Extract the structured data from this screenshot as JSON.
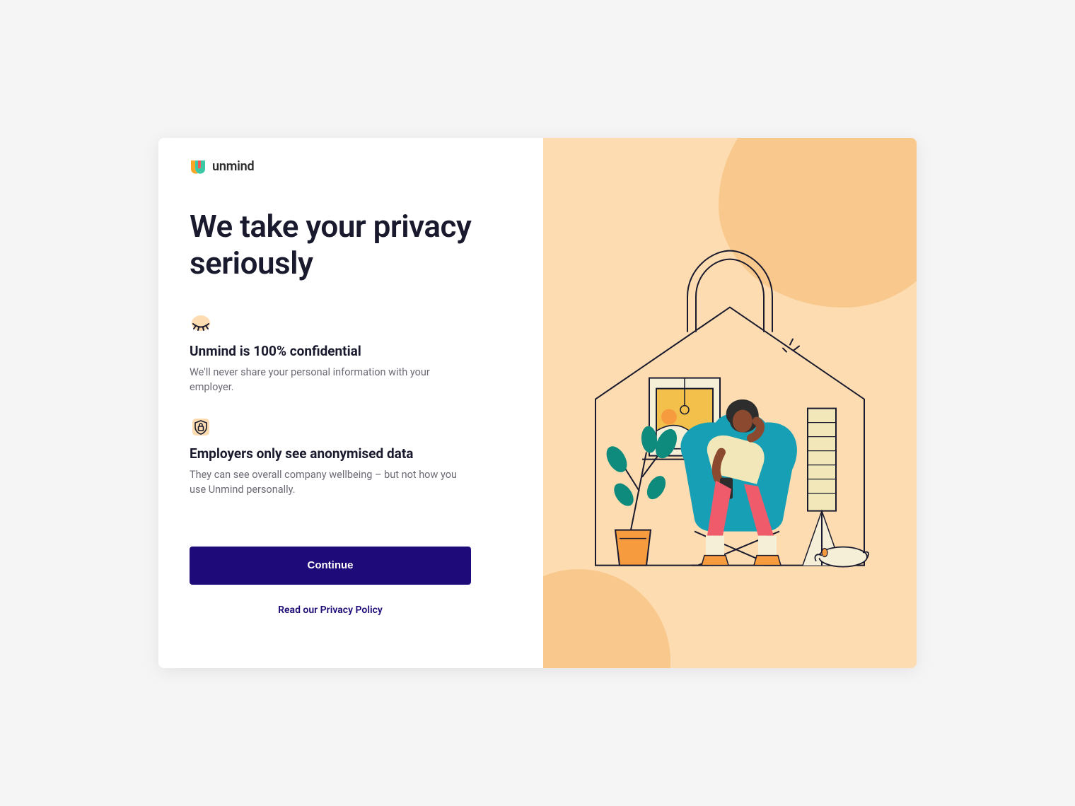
{
  "brand": {
    "name": "unmind"
  },
  "headline": "We take your privacy seriously",
  "features": [
    {
      "icon": "closed-eye-icon",
      "title": "Unmind is 100% confidential",
      "desc": "We'll never share your personal information with your employer."
    },
    {
      "icon": "shield-lock-icon",
      "title": "Employers only see anonymised data",
      "desc": "They can see overall company wellbeing – but not how you use Unmind personally."
    }
  ],
  "actions": {
    "continue_label": "Continue",
    "privacy_link_label": "Read our Privacy Policy"
  },
  "colors": {
    "primary": "#1e0a78",
    "accent_bg": "#fcdcb0",
    "accent_blob": "#f9c88c"
  }
}
